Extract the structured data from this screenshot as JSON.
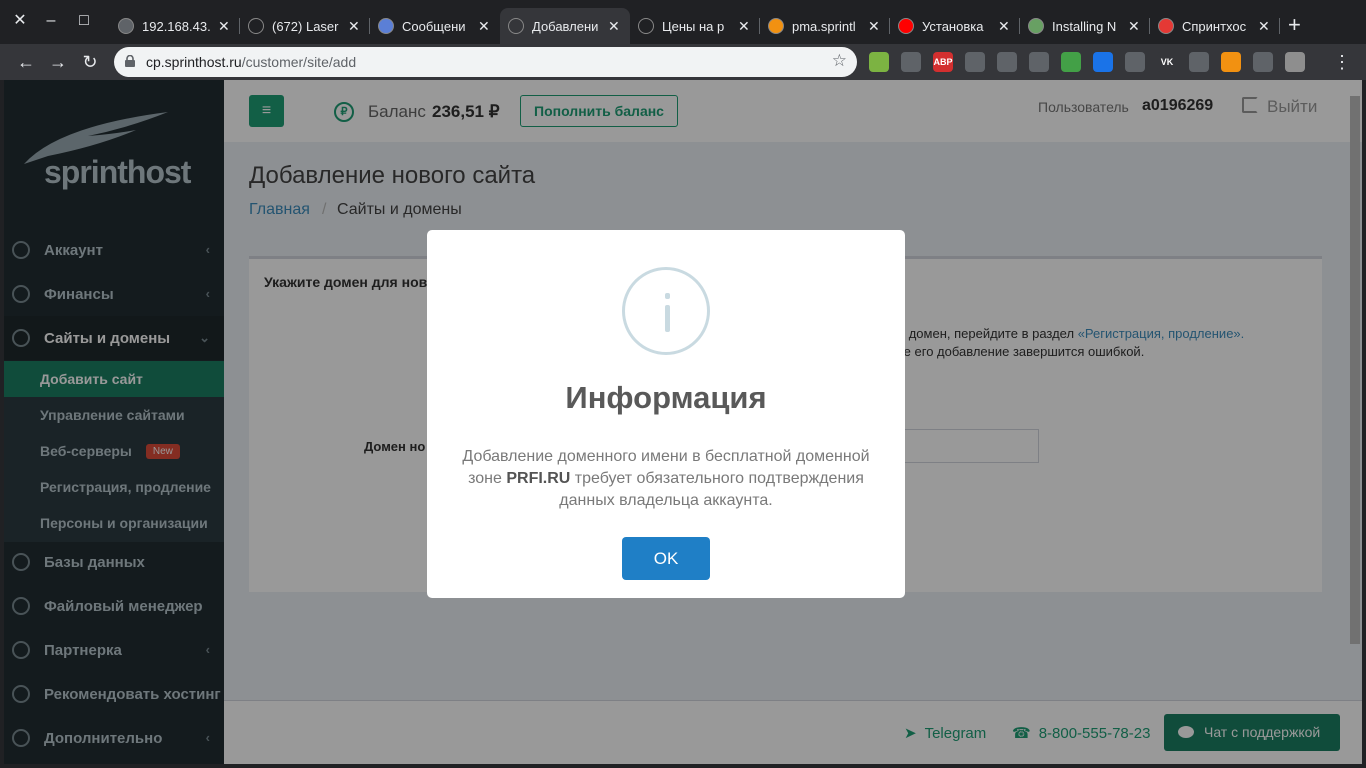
{
  "browser": {
    "tabs": [
      {
        "title": "192.168.43.",
        "favicon": "globe",
        "color": "#5f6368"
      },
      {
        "title": "(672) Laser",
        "favicon": "dot",
        "color": "#202124"
      },
      {
        "title": "Сообщени",
        "favicon": "chat",
        "color": "#5b7fd6"
      },
      {
        "title": "Добавлени",
        "favicon": "sprinthost",
        "color": "#35363a"
      },
      {
        "title": "Цены на р",
        "favicon": "sprinthost",
        "color": "#202124"
      },
      {
        "title": "pma.sprintl",
        "favicon": "pma",
        "color": "#f29111"
      },
      {
        "title": "Установка",
        "favicon": "youtube",
        "color": "#ff0000"
      },
      {
        "title": "Installing N",
        "favicon": "node",
        "color": "#68a063"
      },
      {
        "title": "Спринтхос",
        "favicon": "sprinthost",
        "color": "#e53935"
      }
    ],
    "url_host": "cp.sprinthost.ru",
    "url_path": "/customer/site/add",
    "extensions": [
      {
        "name": "download-ext",
        "color": "#7cb342",
        "label": ""
      },
      {
        "name": "ext-2",
        "color": "#5f6368",
        "label": ""
      },
      {
        "name": "adblock",
        "color": "#d32f2f",
        "label": "ABP"
      },
      {
        "name": "ext-4",
        "color": "#5f6368",
        "label": ""
      },
      {
        "name": "react-devtools",
        "color": "#5f6368",
        "label": ""
      },
      {
        "name": "ext-6",
        "color": "#5f6368",
        "label": ""
      },
      {
        "name": "ext-7",
        "color": "#43a047",
        "label": ""
      },
      {
        "name": "ext-8",
        "color": "#1a73e8",
        "label": ""
      },
      {
        "name": "ext-9",
        "color": "#5f6368",
        "label": ""
      },
      {
        "name": "vk",
        "color": "#35363a",
        "label": "VK"
      },
      {
        "name": "ext-11",
        "color": "#5f6368",
        "label": ""
      },
      {
        "name": "ext-12",
        "color": "#f29111",
        "label": ""
      },
      {
        "name": "ext-13",
        "color": "#5f6368",
        "label": ""
      },
      {
        "name": "profile",
        "color": "#8e8e8e",
        "label": ""
      }
    ]
  },
  "sidebar": {
    "logo": "sprinthost",
    "items": [
      {
        "label": "Аккаунт",
        "chevron": "‹"
      },
      {
        "label": "Финансы",
        "chevron": "‹"
      },
      {
        "label": "Сайты и домены",
        "chevron": "⌄"
      },
      {
        "label": "Базы данных",
        "chevron": ""
      },
      {
        "label": "Файловый менеджер",
        "chevron": ""
      },
      {
        "label": "Партнерка",
        "chevron": "‹"
      },
      {
        "label": "Рекомендовать хостинг",
        "chevron": ""
      },
      {
        "label": "Дополнительно",
        "chevron": "‹"
      }
    ],
    "subitems": [
      {
        "label": "Добавить сайт"
      },
      {
        "label": "Управление сайтами"
      },
      {
        "label": "Веб-серверы",
        "badge": "New"
      },
      {
        "label": "Регистрация, продление"
      },
      {
        "label": "Персоны и организации"
      }
    ]
  },
  "header": {
    "balance_label": "Баланс",
    "balance_value": "236,51 ₽",
    "topup_label": "Пополнить баланс",
    "user_label": "Пользователь",
    "user_value": "a0196269",
    "logout_label": "Выйти"
  },
  "main": {
    "title": "Добавление нового сайта",
    "breadcrumb_home": "Главная",
    "breadcrumb_sep": "/",
    "breadcrumb_current": "Сайты и домены",
    "card_title": "Укажите домен для нов",
    "hint1_text": "ранее домен, перейдите в раздел ",
    "hint1_link": "«Регистрация, продление».",
    "hint2": "торное его добавление завершится ошибкой.",
    "hint3": "е.",
    "field_label": "Домен но"
  },
  "footer": {
    "telegram": "Telegram",
    "phone": "8-800-555-78-23",
    "chat": "Чат с поддержкой"
  },
  "modal": {
    "title": "Информация",
    "text_before": "Добавление доменного имени в бесплатной доменной зоне ",
    "text_bold": "PRFI.RU",
    "text_after": " требует обязательного подтверждения данных владельца аккаунта.",
    "ok_label": "OK"
  },
  "colors": {
    "accent": "#1e9e76",
    "sidebar_bg": "#222d32",
    "ok_button": "#1f7fc6",
    "link": "#3c8dbc"
  }
}
